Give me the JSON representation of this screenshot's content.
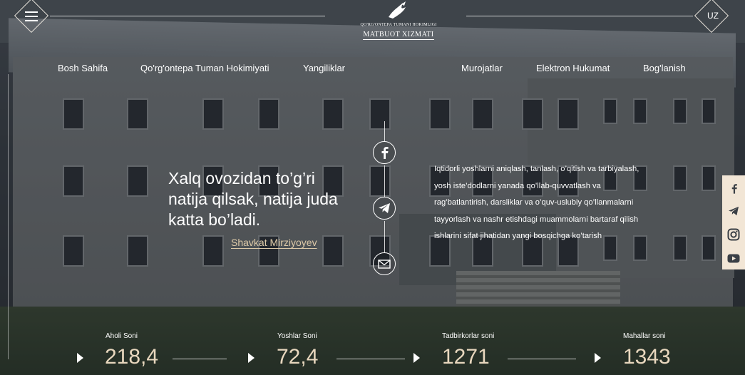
{
  "header": {
    "logo_line1": "QO'RG'ONTEPA TUMANI HOKIMLIGI",
    "logo_line2": "MATBUOT XIZMATI",
    "language": "UZ"
  },
  "nav": [
    "Bosh Sahifa",
    "Qo'rg'ontepa Tuman Hokimiyati",
    "Yangiliklar",
    "Murojatlar",
    "Elektron Hukumat",
    "Bog'lanish"
  ],
  "quote": {
    "text": "Xalq ovozidan to’g’ri natija qilsak, natija juda katta bo’ladi.",
    "author": "Shavkat Mirziyoyev"
  },
  "description": "Iqtidorli yoshlarni aniqlash, tanlash, o’qitish va tarbiyalash, yosh iste’dodlarni yanada qo’llab-quvvatlash va rag’batlantirish, darsliklar va o’quv-uslubiy qo’llanmalarni tayyorlash va nashr etishdagi muammolarni bartaraf qilish ishlarini sifat jihatidan yangi bosqichga ko’tarish",
  "social_center": [
    "facebook-icon",
    "telegram-icon",
    "mail-icon"
  ],
  "social_side": [
    "facebook-icon",
    "telegram-icon",
    "instagram-icon",
    "youtube-icon"
  ],
  "stats": [
    {
      "label": "Aholi Soni",
      "value": "218,4"
    },
    {
      "label": "Yoshlar Soni",
      "value": "72,4"
    },
    {
      "label": "Tadbirkorlar soni",
      "value": "1271"
    },
    {
      "label": "Mahallar soni",
      "value": "1343"
    }
  ],
  "colors": {
    "accent": "#e8d7be",
    "author": "#dcc9a8",
    "side_bar": "#f2e6d6",
    "icon_dark": "#3b4046"
  }
}
